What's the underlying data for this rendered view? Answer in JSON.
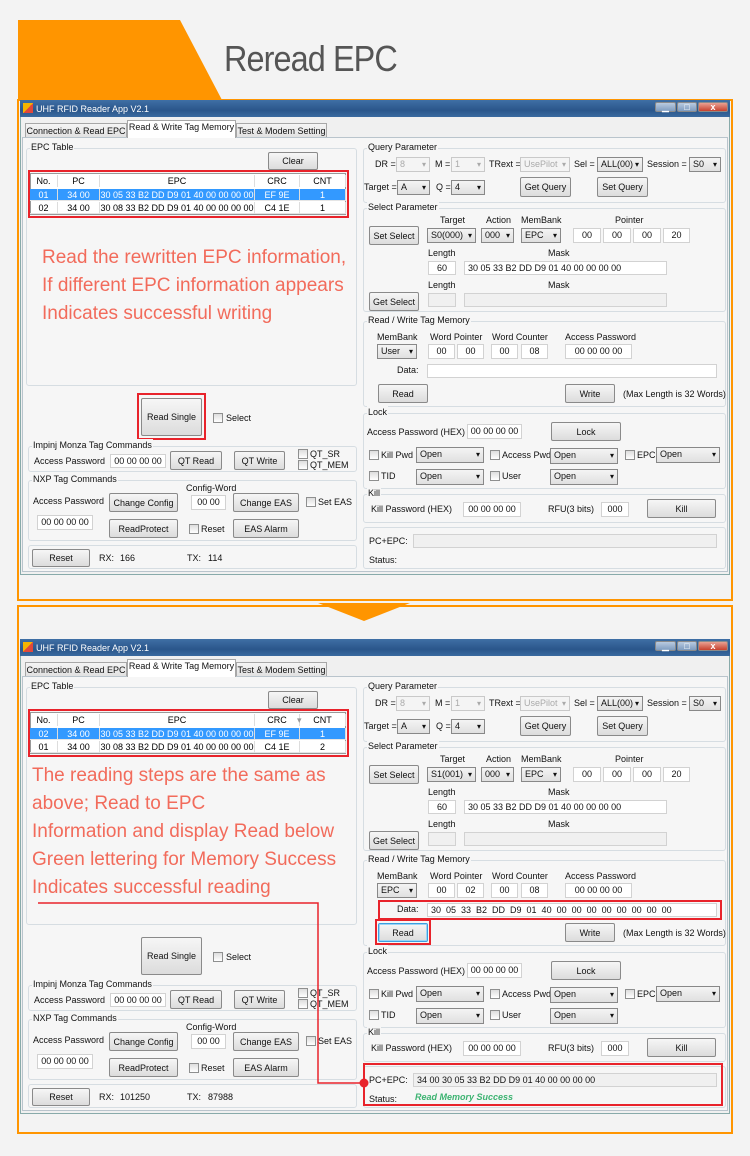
{
  "page": {
    "title": "Reread EPC",
    "accent": "#ff9500",
    "annotation_color": "#f26b5b",
    "status_success_color": "#3cb371"
  },
  "app": {
    "title": "UHF RFID Reader App V2.1",
    "tabs": [
      "Connection & Read EPC",
      "Read & Write Tag Memory",
      "Test & Modem Setting"
    ],
    "active_tab": "Read & Write Tag Memory"
  },
  "labels": {
    "epc_table": "EPC Table",
    "clear": "Clear",
    "columns": [
      "No.",
      "PC",
      "EPC",
      "CRC",
      "CNT"
    ],
    "read_single": "Read Single",
    "select": "Select",
    "impinj": "Impinj Monza Tag Commands",
    "access_password": "Access Password",
    "impinj_pw": "00 00 00 00",
    "qt_read": "QT Read",
    "qt_write": "QT Write",
    "qt_sr": "QT_SR",
    "qt_mem": "QT_MEM",
    "nxp": "NXP Tag Commands",
    "config_word": "Config-Word",
    "config_val": "00 00",
    "change_config": "Change Config",
    "change_eas": "Change EAS",
    "set_eas": "Set EAS",
    "nxp_pw": "00 00 00 00",
    "read_protect": "ReadProtect",
    "reset_cb": "Reset",
    "eas_alarm": "EAS Alarm",
    "reset_btn": "Reset",
    "rx": "RX:",
    "tx": "TX:",
    "query": "Query Parameter",
    "dr": "DR =",
    "dr_val": "8",
    "m": "M =",
    "m_val": "1",
    "trext": "TRext =",
    "trext_val": "UsePilot",
    "sel": "Sel =",
    "sel_val": "ALL(00)",
    "session": "Session =",
    "session_val": "S0",
    "target": "Target =",
    "target_val": "A",
    "q": "Q =",
    "q_val": "4",
    "get_query": "Get Query",
    "set_query": "Set Query",
    "select_param": "Select Parameter",
    "target_h": "Target",
    "action_h": "Action",
    "membank_h": "MemBank",
    "pointer_h": "Pointer",
    "set_select": "Set Select",
    "action_val": "000",
    "membank_val": "EPC",
    "pointer": [
      "00",
      "00",
      "00",
      "20"
    ],
    "length": "Length",
    "mask": "Mask",
    "length_val": "60",
    "mask_val": "30 05 33 B2 DD D9 01 40 00 00 00 00",
    "get_select": "Get Select",
    "rw": "Read / Write Tag Memory",
    "membank": "MemBank",
    "word_pointer": "Word Pointer",
    "word_counter": "Word Counter",
    "access_pw_h": "Access Password",
    "access_pw_val": "00 00 00 00",
    "data": "Data:",
    "read": "Read",
    "write": "Write",
    "max_len": "(Max Length is 32 Words)",
    "lock": "Lock",
    "lock_ap": "Access Password (HEX)",
    "lock_ap_val": "00 00 00 00",
    "lock_btn": "Lock",
    "kill_pwd": "Kill Pwd",
    "access_pwd": "Access Pwd",
    "epc": "EPC",
    "tid": "TID",
    "user": "User",
    "open": "Open",
    "kill": "Kill",
    "kill_pw": "Kill Password (HEX)",
    "kill_pw_val": "00 00 00 00",
    "rfu": "RFU(3 bits)",
    "rfu_val": "000",
    "kill_btn": "Kill",
    "pc_epc": "PC+EPC:",
    "status": "Status:"
  },
  "windows": [
    {
      "epc_rows": [
        [
          "01",
          "34 00",
          "30 05 33 B2 DD D9 01 40 00 00 00 00",
          "EF 9E",
          "1"
        ],
        [
          "02",
          "34 00",
          "30 08 33 B2 DD D9 01 40 00 00 00 00",
          "C4 1E",
          "1"
        ]
      ],
      "selected_row": 0,
      "annotation": [
        "Read the rewritten EPC information,",
        "If different EPC information appears",
        "Indicates successful writing"
      ],
      "select_target": "S0(000)",
      "rw_membank": "User",
      "word_pointer": [
        "00",
        "00"
      ],
      "word_counter": [
        "00",
        "08"
      ],
      "data": "",
      "pc_epc": "",
      "status": "",
      "rx": "166",
      "tx": "114"
    },
    {
      "epc_rows": [
        [
          "02",
          "34 00",
          "30 05 33 B2 DD D9 01 40 00 00 00 00",
          "EF 9E",
          "1"
        ],
        [
          "01",
          "34 00",
          "30 08 33 B2 DD D9 01 40 00 00 00 00",
          "C4 1E",
          "2"
        ]
      ],
      "selected_row": 0,
      "annotation": [
        "The reading steps are the same as",
        "above; Read to EPC",
        "Information and display Read below",
        "Green lettering for Memory Success",
        "Indicates successful reading"
      ],
      "select_target": "S1(001)",
      "rw_membank": "EPC",
      "word_pointer": [
        "00",
        "02"
      ],
      "word_counter": [
        "00",
        "08"
      ],
      "data": "30  05  33  B2  DD  D9  01  40  00  00  00  00  00  00  00  00",
      "pc_epc": "34 00 30 05 33 B2 DD D9 01 40 00 00 00 00",
      "status": "Read Memory Success",
      "rx": "101250",
      "tx": "87988"
    }
  ]
}
